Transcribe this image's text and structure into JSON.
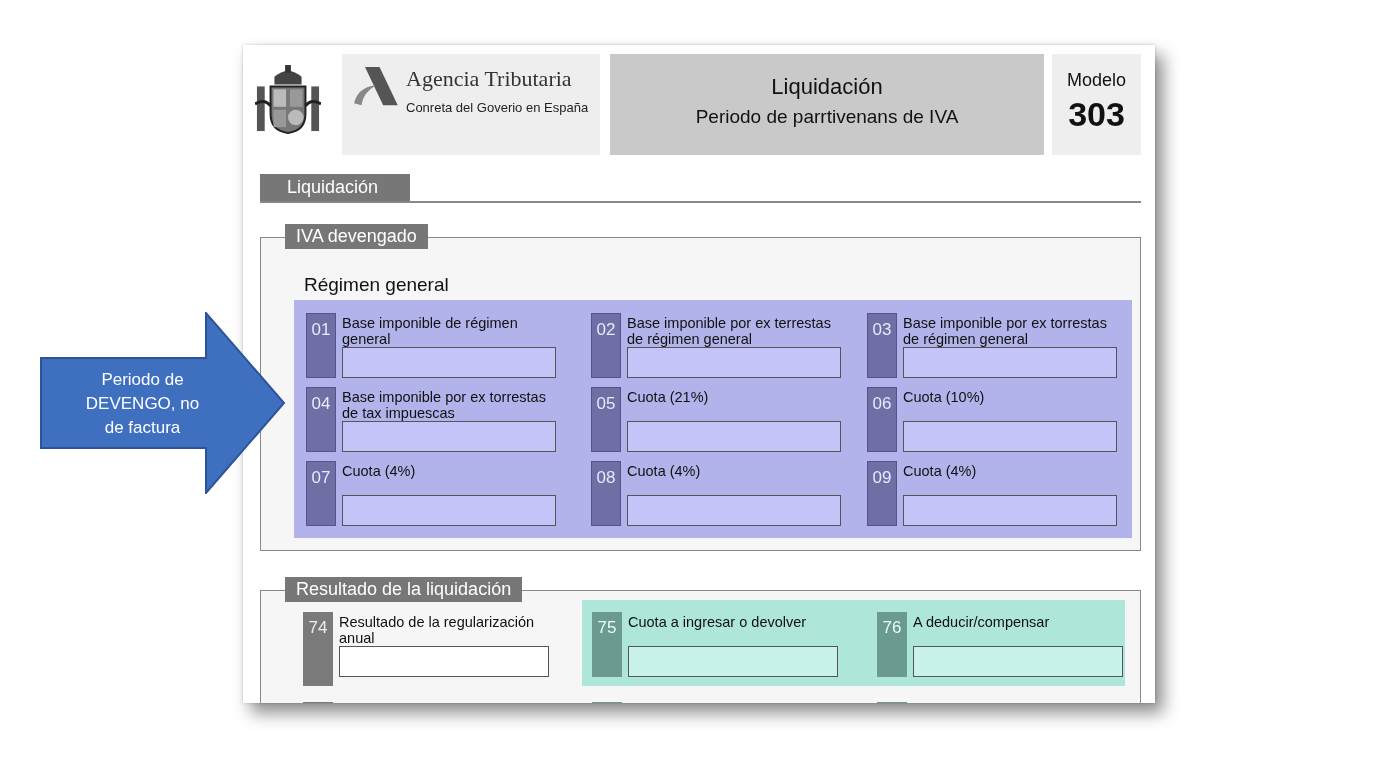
{
  "callout": {
    "text": "Periodo de DEVENGO, no de factura"
  },
  "header": {
    "agency": {
      "name": "Agencia Tributaria",
      "subtitle": "Conreta del Goverio en España"
    },
    "title": "Liquidación",
    "subtitle": "Periodo de parrtivenans de IVA",
    "model_label": "Modelo",
    "model_number": "303"
  },
  "section": {
    "title": "Liquidación"
  },
  "iva_devengado": {
    "legend": "IVA devengado",
    "heading": "Régimen general",
    "fields": [
      {
        "number": "01",
        "label": "Base imponible de régimen general"
      },
      {
        "number": "02",
        "label": "Base imponible por ex terrestas de régimen general"
      },
      {
        "number": "03",
        "label": "Base imponible por ex torrestas de régimen general"
      },
      {
        "number": "04",
        "label": "Base imponible por ex torrestas de tax impuescas"
      },
      {
        "number": "05",
        "label": "Cuota (21%)"
      },
      {
        "number": "06",
        "label": "Cuota (10%)"
      },
      {
        "number": "07",
        "label": "Cuota (4%)"
      },
      {
        "number": "08",
        "label": "Cuota (4%)"
      },
      {
        "number": "09",
        "label": "Cuota (4%)"
      }
    ]
  },
  "resultado": {
    "legend": "Resultado de la liquidación",
    "fields": [
      {
        "number": "74",
        "label": "Resultado de la regularización anual",
        "highlighted": false
      },
      {
        "number": "75",
        "label": "Cuota a ingresar o devolver",
        "highlighted": true
      },
      {
        "number": "76",
        "label": "A deducir/compensar",
        "highlighted": true
      }
    ]
  }
}
